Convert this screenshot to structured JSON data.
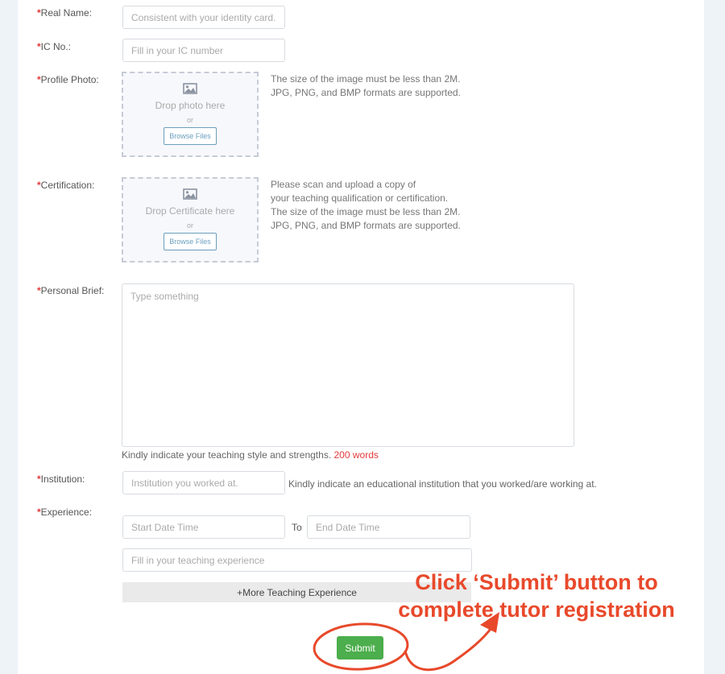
{
  "form": {
    "required_mark": "*",
    "real_name": {
      "label": "Real Name:",
      "placeholder": "Consistent with your identity card."
    },
    "ic_no": {
      "label": "IC No.:",
      "placeholder": "Fill in your IC number"
    },
    "profile_photo": {
      "label": "Profile Photo:",
      "drop_text": "Drop photo here",
      "or": "or",
      "browse": "Browse Files",
      "note_lines": [
        "The size of the image must be less than 2M.",
        "JPG, PNG, and BMP formats are supported."
      ]
    },
    "certification": {
      "label": "Certification:",
      "drop_text": "Drop Certificate here",
      "or": "or",
      "browse": "Browse Files",
      "note_lines": [
        "Please scan and upload a copy of",
        "your teaching qualification or certification.",
        "The size of the image must be less than 2M.",
        "JPG, PNG, and BMP formats are supported."
      ]
    },
    "personal_brief": {
      "label": "Personal Brief:",
      "placeholder": "Type something",
      "hint": "Kindly indicate your teaching style and strengths.",
      "limit": "200 words"
    },
    "institution": {
      "label": "Institution:",
      "placeholder": "Institution you worked at.",
      "hint": "Kindly indicate an educational institution that you worked/are working at."
    },
    "experience": {
      "label": "Experience:",
      "start_placeholder": "Start Date Time",
      "to": "To",
      "end_placeholder": "End Date Time",
      "detail_placeholder": "Fill in your teaching experience",
      "more_button": "+More Teaching Experience"
    },
    "submit": "Submit"
  },
  "annotation": {
    "lines": [
      "Click ‘Submit’ button to",
      "complete tutor registration"
    ],
    "color": "#e8492b"
  },
  "colors": {
    "accent_red": "#e4393c",
    "submit_green": "#4cae4c",
    "browse_blue": "#6b9fbd"
  }
}
